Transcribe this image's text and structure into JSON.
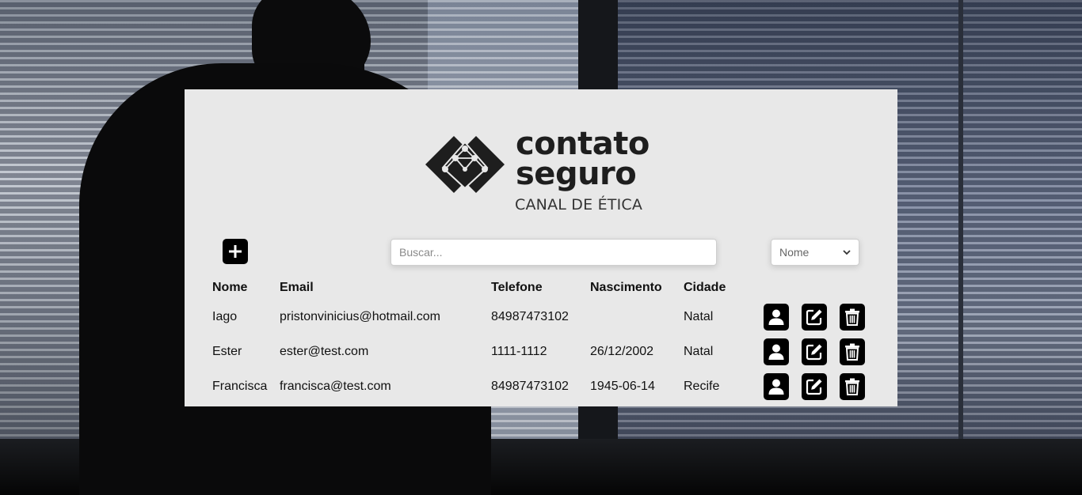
{
  "brand": {
    "name_line1": "contato",
    "name_line2": "seguro",
    "subtitle": "CANAL DE ÉTICA"
  },
  "toolbar": {
    "add_icon": "plus-icon",
    "search_placeholder": "Buscar...",
    "search_value": "",
    "sort_selected": "Nome",
    "sort_options": [
      "Nome"
    ]
  },
  "table": {
    "headers": {
      "nome": "Nome",
      "email": "Email",
      "telefone": "Telefone",
      "nascimento": "Nascimento",
      "cidade": "Cidade"
    },
    "rows": [
      {
        "nome": "Iago",
        "email": "pristonvinicius@hotmail.com",
        "telefone": "84987473102",
        "nascimento": "",
        "cidade": "Natal"
      },
      {
        "nome": "Ester",
        "email": "ester@test.com",
        "telefone": "1111-1112",
        "nascimento": "26/12/2002",
        "cidade": "Natal"
      },
      {
        "nome": "Francisca",
        "email": "francisca@test.com",
        "telefone": "84987473102",
        "nascimento": "1945-06-14",
        "cidade": "Recife"
      }
    ],
    "row_actions": [
      "user-icon",
      "edit-icon",
      "trash-icon"
    ]
  },
  "colors": {
    "card_background": "#e8e8e8",
    "button_background": "#000000",
    "logo_color": "#1e1e1e"
  }
}
